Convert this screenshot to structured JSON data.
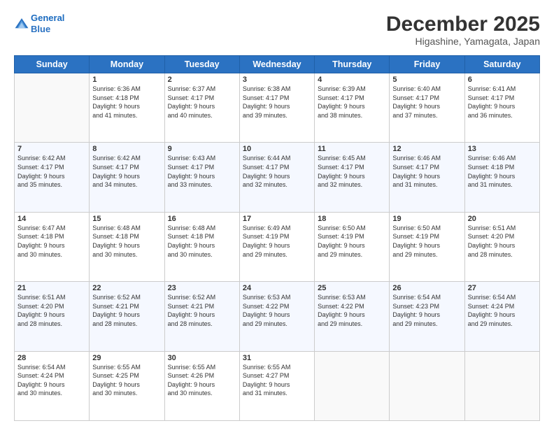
{
  "header": {
    "logo_line1": "General",
    "logo_line2": "Blue",
    "month": "December 2025",
    "location": "Higashine, Yamagata, Japan"
  },
  "weekdays": [
    "Sunday",
    "Monday",
    "Tuesday",
    "Wednesday",
    "Thursday",
    "Friday",
    "Saturday"
  ],
  "weeks": [
    [
      {
        "day": "",
        "info": ""
      },
      {
        "day": "1",
        "info": "Sunrise: 6:36 AM\nSunset: 4:18 PM\nDaylight: 9 hours\nand 41 minutes."
      },
      {
        "day": "2",
        "info": "Sunrise: 6:37 AM\nSunset: 4:17 PM\nDaylight: 9 hours\nand 40 minutes."
      },
      {
        "day": "3",
        "info": "Sunrise: 6:38 AM\nSunset: 4:17 PM\nDaylight: 9 hours\nand 39 minutes."
      },
      {
        "day": "4",
        "info": "Sunrise: 6:39 AM\nSunset: 4:17 PM\nDaylight: 9 hours\nand 38 minutes."
      },
      {
        "day": "5",
        "info": "Sunrise: 6:40 AM\nSunset: 4:17 PM\nDaylight: 9 hours\nand 37 minutes."
      },
      {
        "day": "6",
        "info": "Sunrise: 6:41 AM\nSunset: 4:17 PM\nDaylight: 9 hours\nand 36 minutes."
      }
    ],
    [
      {
        "day": "7",
        "info": "Sunrise: 6:42 AM\nSunset: 4:17 PM\nDaylight: 9 hours\nand 35 minutes."
      },
      {
        "day": "8",
        "info": "Sunrise: 6:42 AM\nSunset: 4:17 PM\nDaylight: 9 hours\nand 34 minutes."
      },
      {
        "day": "9",
        "info": "Sunrise: 6:43 AM\nSunset: 4:17 PM\nDaylight: 9 hours\nand 33 minutes."
      },
      {
        "day": "10",
        "info": "Sunrise: 6:44 AM\nSunset: 4:17 PM\nDaylight: 9 hours\nand 32 minutes."
      },
      {
        "day": "11",
        "info": "Sunrise: 6:45 AM\nSunset: 4:17 PM\nDaylight: 9 hours\nand 32 minutes."
      },
      {
        "day": "12",
        "info": "Sunrise: 6:46 AM\nSunset: 4:17 PM\nDaylight: 9 hours\nand 31 minutes."
      },
      {
        "day": "13",
        "info": "Sunrise: 6:46 AM\nSunset: 4:18 PM\nDaylight: 9 hours\nand 31 minutes."
      }
    ],
    [
      {
        "day": "14",
        "info": "Sunrise: 6:47 AM\nSunset: 4:18 PM\nDaylight: 9 hours\nand 30 minutes."
      },
      {
        "day": "15",
        "info": "Sunrise: 6:48 AM\nSunset: 4:18 PM\nDaylight: 9 hours\nand 30 minutes."
      },
      {
        "day": "16",
        "info": "Sunrise: 6:48 AM\nSunset: 4:18 PM\nDaylight: 9 hours\nand 30 minutes."
      },
      {
        "day": "17",
        "info": "Sunrise: 6:49 AM\nSunset: 4:19 PM\nDaylight: 9 hours\nand 29 minutes."
      },
      {
        "day": "18",
        "info": "Sunrise: 6:50 AM\nSunset: 4:19 PM\nDaylight: 9 hours\nand 29 minutes."
      },
      {
        "day": "19",
        "info": "Sunrise: 6:50 AM\nSunset: 4:19 PM\nDaylight: 9 hours\nand 29 minutes."
      },
      {
        "day": "20",
        "info": "Sunrise: 6:51 AM\nSunset: 4:20 PM\nDaylight: 9 hours\nand 28 minutes."
      }
    ],
    [
      {
        "day": "21",
        "info": "Sunrise: 6:51 AM\nSunset: 4:20 PM\nDaylight: 9 hours\nand 28 minutes."
      },
      {
        "day": "22",
        "info": "Sunrise: 6:52 AM\nSunset: 4:21 PM\nDaylight: 9 hours\nand 28 minutes."
      },
      {
        "day": "23",
        "info": "Sunrise: 6:52 AM\nSunset: 4:21 PM\nDaylight: 9 hours\nand 28 minutes."
      },
      {
        "day": "24",
        "info": "Sunrise: 6:53 AM\nSunset: 4:22 PM\nDaylight: 9 hours\nand 29 minutes."
      },
      {
        "day": "25",
        "info": "Sunrise: 6:53 AM\nSunset: 4:22 PM\nDaylight: 9 hours\nand 29 minutes."
      },
      {
        "day": "26",
        "info": "Sunrise: 6:54 AM\nSunset: 4:23 PM\nDaylight: 9 hours\nand 29 minutes."
      },
      {
        "day": "27",
        "info": "Sunrise: 6:54 AM\nSunset: 4:24 PM\nDaylight: 9 hours\nand 29 minutes."
      }
    ],
    [
      {
        "day": "28",
        "info": "Sunrise: 6:54 AM\nSunset: 4:24 PM\nDaylight: 9 hours\nand 30 minutes."
      },
      {
        "day": "29",
        "info": "Sunrise: 6:55 AM\nSunset: 4:25 PM\nDaylight: 9 hours\nand 30 minutes."
      },
      {
        "day": "30",
        "info": "Sunrise: 6:55 AM\nSunset: 4:26 PM\nDaylight: 9 hours\nand 30 minutes."
      },
      {
        "day": "31",
        "info": "Sunrise: 6:55 AM\nSunset: 4:27 PM\nDaylight: 9 hours\nand 31 minutes."
      },
      {
        "day": "",
        "info": ""
      },
      {
        "day": "",
        "info": ""
      },
      {
        "day": "",
        "info": ""
      }
    ]
  ]
}
